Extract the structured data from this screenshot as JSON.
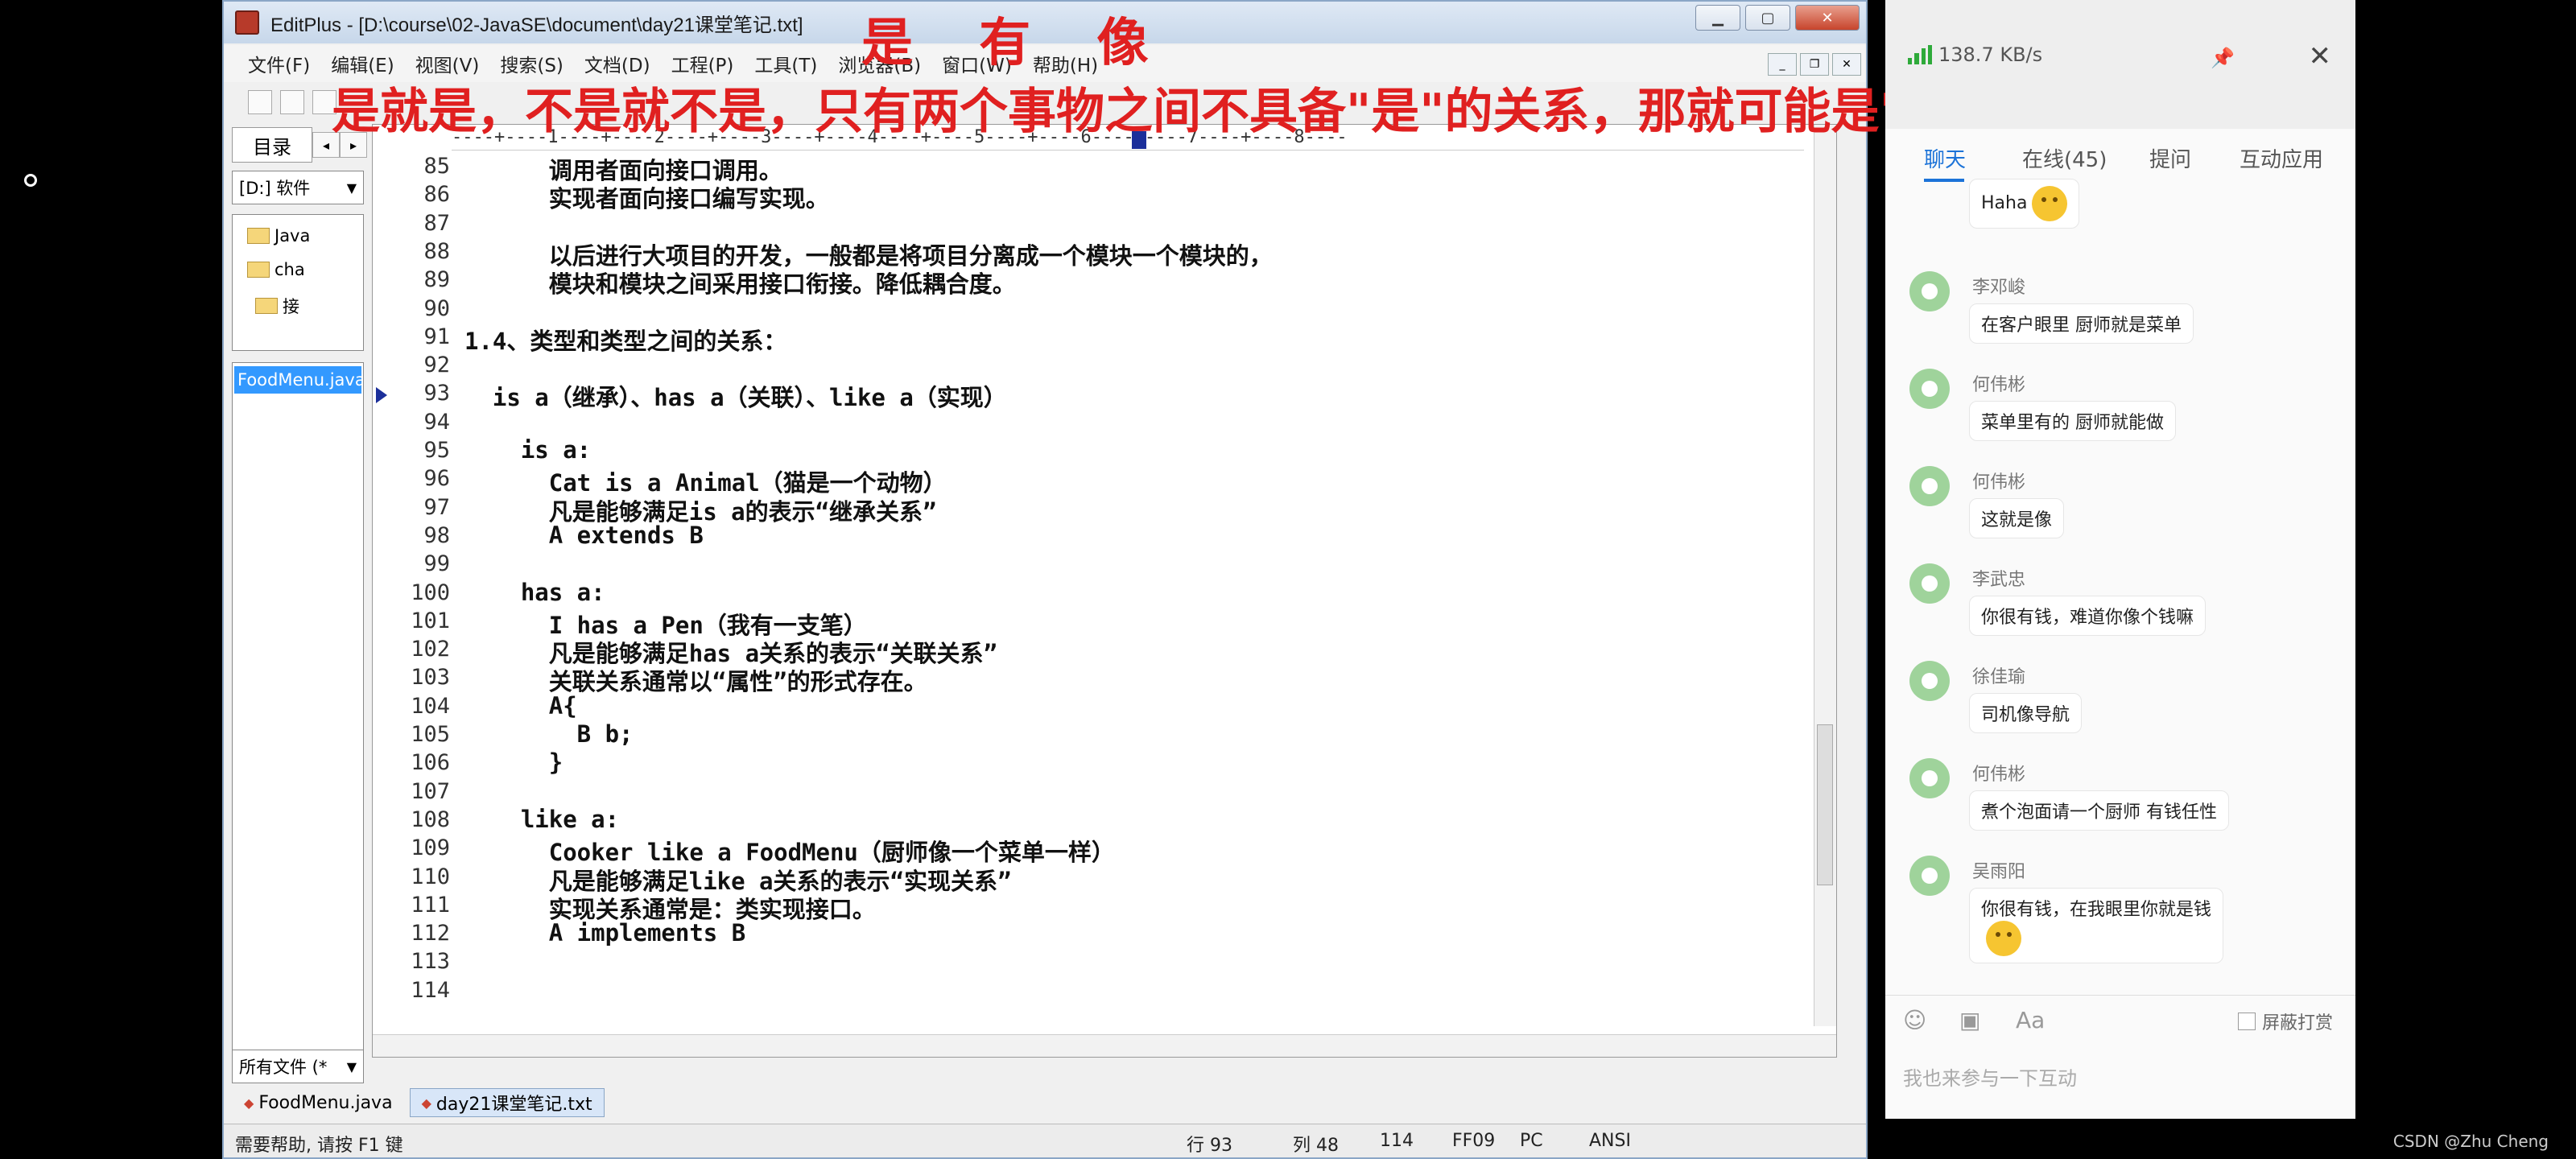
{
  "window": {
    "title": "EditPlus - [D:\\course\\02-JavaSE\\document\\day21课堂笔记.txt]",
    "controls": [
      "▁",
      "▢",
      "✕"
    ]
  },
  "overlay": {
    "title": "是 有 像",
    "subtitle": "是就是，不是就不是，只有两个事物之间不具备\"是\"的关系，那就可能是\"像\"的关系"
  },
  "menu": [
    "文件(F)",
    "编辑(E)",
    "视图(V)",
    "搜索(S)",
    "文档(D)",
    "工程(P)",
    "工具(T)",
    "浏览器(B)",
    "窗口(W)",
    "帮助(H)"
  ],
  "directory": {
    "tab": "目录",
    "drive": "[D:] 软件",
    "tree": [
      "Java",
      "cha",
      "接"
    ],
    "selected_file": "FoodMenu.java",
    "filter": "所有文件 (*"
  },
  "ruler": "----+----1----+----2----+----3----+----4----+----5----+----6----+----7----+----8----",
  "lines": [
    {
      "no": "85",
      "text": "      调用者面向接口调用。"
    },
    {
      "no": "86",
      "text": "      实现者面向接口编写实现。"
    },
    {
      "no": "87",
      "text": ""
    },
    {
      "no": "88",
      "text": "      以后进行大项目的开发，一般都是将项目分离成一个模块一个模块的，"
    },
    {
      "no": "89",
      "text": "      模块和模块之间采用接口衔接。降低耦合度。"
    },
    {
      "no": "90",
      "text": ""
    },
    {
      "no": "91",
      "text": "1.4、类型和类型之间的关系："
    },
    {
      "no": "92",
      "text": ""
    },
    {
      "no": "93",
      "text": "  is a（继承）、has a（关联）、like a（实现）"
    },
    {
      "no": "94",
      "text": ""
    },
    {
      "no": "95",
      "text": "    is a:"
    },
    {
      "no": "96",
      "text": "      Cat is a Animal（猫是一个动物）"
    },
    {
      "no": "97",
      "text": "      凡是能够满足is a的表示“继承关系”"
    },
    {
      "no": "98",
      "text": "      A extends B"
    },
    {
      "no": "99",
      "text": ""
    },
    {
      "no": "100",
      "text": "    has a:"
    },
    {
      "no": "101",
      "text": "      I has a Pen（我有一支笔）"
    },
    {
      "no": "102",
      "text": "      凡是能够满足has a关系的表示“关联关系”"
    },
    {
      "no": "103",
      "text": "      关联关系通常以“属性”的形式存在。"
    },
    {
      "no": "104",
      "text": "      A{"
    },
    {
      "no": "105",
      "text": "        B b;"
    },
    {
      "no": "106",
      "text": "      }"
    },
    {
      "no": "107",
      "text": ""
    },
    {
      "no": "108",
      "text": "    like a:"
    },
    {
      "no": "109",
      "text": "      Cooker like a FoodMenu（厨师像一个菜单一样）"
    },
    {
      "no": "110",
      "text": "      凡是能够满足like a关系的表示“实现关系”"
    },
    {
      "no": "111",
      "text": "      实现关系通常是：类实现接口。"
    },
    {
      "no": "112",
      "text": "      A implements B"
    },
    {
      "no": "113",
      "text": ""
    },
    {
      "no": "114",
      "text": ""
    }
  ],
  "doc_tabs": [
    "FoodMenu.java",
    "day21课堂笔记.txt"
  ],
  "status": {
    "help": "需要帮助, 请按 F1 键",
    "line": "行 93",
    "col": "列 48",
    "total": "114",
    "code": "FF09",
    "mode": "PC",
    "encoding": "ANSI"
  },
  "chat": {
    "speed": "138.7 KB/s",
    "close": "✕",
    "tabs": [
      "聊天",
      "在线(45)",
      "提问",
      "互动应用"
    ],
    "messages": [
      {
        "sender": "",
        "text": "Haha",
        "emoji": true
      },
      {
        "sender": "李邓峻",
        "text": "在客户眼里 厨师就是菜单",
        "emoji": false
      },
      {
        "sender": "何伟彬",
        "text": "菜单里有的 厨师就能做",
        "emoji": false
      },
      {
        "sender": "何伟彬",
        "text": "这就是像",
        "emoji": false
      },
      {
        "sender": "李武忠",
        "text": "你很有钱，难道你像个钱嘛",
        "emoji": false
      },
      {
        "sender": "徐佳瑜",
        "text": "司机像导航",
        "emoji": false
      },
      {
        "sender": "何伟彬",
        "text": "煮个泡面请一个厨师 有钱任性",
        "emoji": false
      },
      {
        "sender": "吴雨阳",
        "text": "你很有钱，在我眼里你就是钱",
        "emoji": true
      }
    ],
    "shield_label": "屏蔽打赏",
    "input_placeholder": "我也来参与一下互动"
  },
  "watermark": "CSDN @Zhu Cheng"
}
